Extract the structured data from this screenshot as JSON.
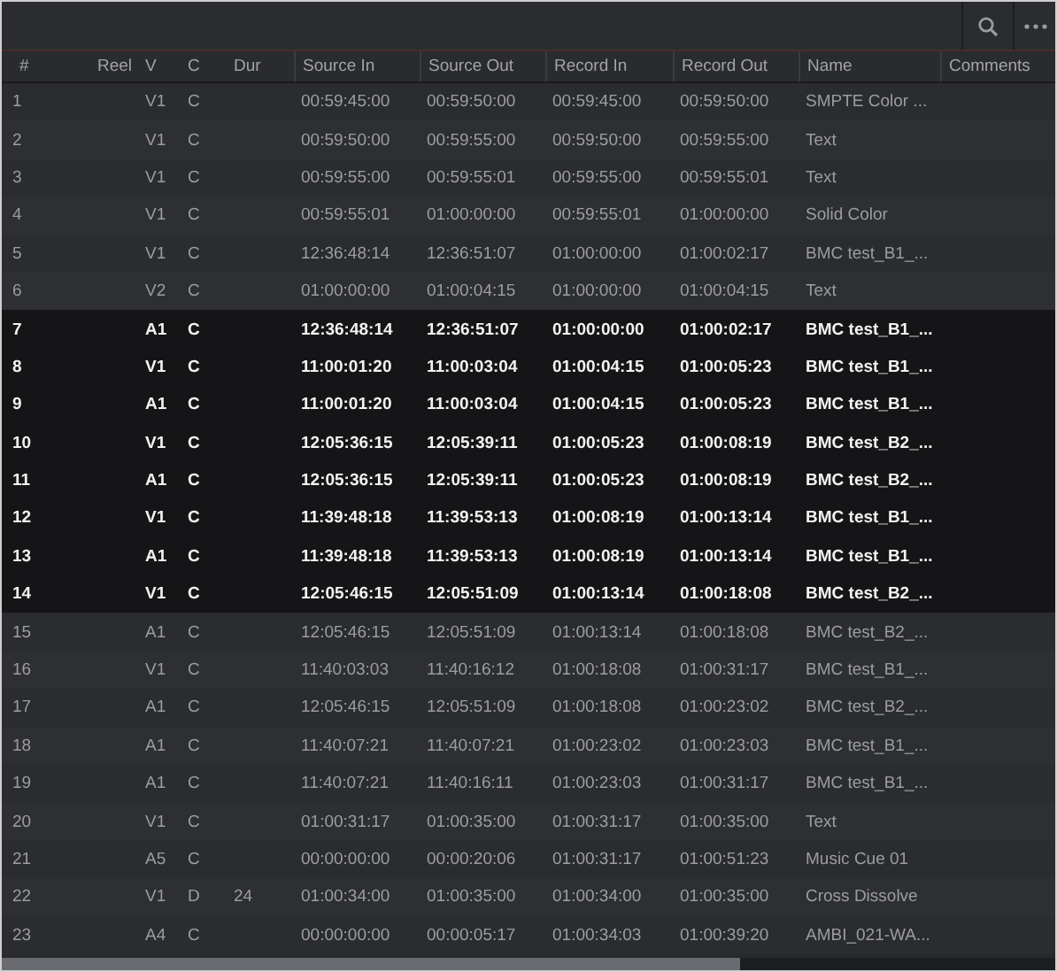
{
  "toolbar": {
    "buttons": [
      {
        "kind": "search"
      },
      {
        "kind": "more"
      }
    ]
  },
  "table": {
    "columns": [
      "#",
      "Reel",
      "V",
      "C",
      "Dur",
      "Source In",
      "Source Out",
      "Record In",
      "Record Out",
      "Name",
      "Comments"
    ],
    "rows": [
      {
        "number": "1",
        "v": "V1",
        "c": "C",
        "source_in": "00:59:45:00",
        "source_out": "00:59:50:00",
        "record_in": "00:59:45:00",
        "record_out": "00:59:50:00",
        "name": "SMPTE Color ...",
        "selected": false
      },
      {
        "number": "2",
        "v": "V1",
        "c": "C",
        "source_in": "00:59:50:00",
        "source_out": "00:59:55:00",
        "record_in": "00:59:50:00",
        "record_out": "00:59:55:00",
        "name": "Text",
        "selected": false
      },
      {
        "number": "3",
        "v": "V1",
        "c": "C",
        "source_in": "00:59:55:00",
        "source_out": "00:59:55:01",
        "record_in": "00:59:55:00",
        "record_out": "00:59:55:01",
        "name": "Text",
        "selected": false
      },
      {
        "number": "4",
        "v": "V1",
        "c": "C",
        "source_in": "00:59:55:01",
        "source_out": "01:00:00:00",
        "record_in": "00:59:55:01",
        "record_out": "01:00:00:00",
        "name": "Solid Color",
        "selected": false
      },
      {
        "number": "5",
        "v": "V1",
        "c": "C",
        "source_in": "12:36:48:14",
        "source_out": "12:36:51:07",
        "record_in": "01:00:00:00",
        "record_out": "01:00:02:17",
        "name": "BMC test_B1_...",
        "selected": false
      },
      {
        "number": "6",
        "v": "V2",
        "c": "C",
        "source_in": "01:00:00:00",
        "source_out": "01:00:04:15",
        "record_in": "01:00:00:00",
        "record_out": "01:00:04:15",
        "name": "Text",
        "selected": false
      },
      {
        "number": "7",
        "v": "A1",
        "c": "C",
        "source_in": "12:36:48:14",
        "source_out": "12:36:51:07",
        "record_in": "01:00:00:00",
        "record_out": "01:00:02:17",
        "name": "BMC test_B1_...",
        "selected": true
      },
      {
        "number": "8",
        "v": "V1",
        "c": "C",
        "source_in": "11:00:01:20",
        "source_out": "11:00:03:04",
        "record_in": "01:00:04:15",
        "record_out": "01:00:05:23",
        "name": "BMC test_B1_...",
        "selected": true
      },
      {
        "number": "9",
        "v": "A1",
        "c": "C",
        "source_in": "11:00:01:20",
        "source_out": "11:00:03:04",
        "record_in": "01:00:04:15",
        "record_out": "01:00:05:23",
        "name": "BMC test_B1_...",
        "selected": true
      },
      {
        "number": "10",
        "v": "V1",
        "c": "C",
        "source_in": "12:05:36:15",
        "source_out": "12:05:39:11",
        "record_in": "01:00:05:23",
        "record_out": "01:00:08:19",
        "name": "BMC test_B2_...",
        "selected": true
      },
      {
        "number": "11",
        "v": "A1",
        "c": "C",
        "source_in": "12:05:36:15",
        "source_out": "12:05:39:11",
        "record_in": "01:00:05:23",
        "record_out": "01:00:08:19",
        "name": "BMC test_B2_...",
        "selected": true
      },
      {
        "number": "12",
        "v": "V1",
        "c": "C",
        "source_in": "11:39:48:18",
        "source_out": "11:39:53:13",
        "record_in": "01:00:08:19",
        "record_out": "01:00:13:14",
        "name": "BMC test_B1_...",
        "selected": true
      },
      {
        "number": "13",
        "v": "A1",
        "c": "C",
        "source_in": "11:39:48:18",
        "source_out": "11:39:53:13",
        "record_in": "01:00:08:19",
        "record_out": "01:00:13:14",
        "name": "BMC test_B1_...",
        "selected": true
      },
      {
        "number": "14",
        "v": "V1",
        "c": "C",
        "source_in": "12:05:46:15",
        "source_out": "12:05:51:09",
        "record_in": "01:00:13:14",
        "record_out": "01:00:18:08",
        "name": "BMC test_B2_...",
        "selected": true
      },
      {
        "number": "15",
        "v": "A1",
        "c": "C",
        "source_in": "12:05:46:15",
        "source_out": "12:05:51:09",
        "record_in": "01:00:13:14",
        "record_out": "01:00:18:08",
        "name": "BMC test_B2_...",
        "selected": false
      },
      {
        "number": "16",
        "v": "V1",
        "c": "C",
        "source_in": "11:40:03:03",
        "source_out": "11:40:16:12",
        "record_in": "01:00:18:08",
        "record_out": "01:00:31:17",
        "name": "BMC test_B1_...",
        "selected": false
      },
      {
        "number": "17",
        "v": "A1",
        "c": "C",
        "source_in": "12:05:46:15",
        "source_out": "12:05:51:09",
        "record_in": "01:00:18:08",
        "record_out": "01:00:23:02",
        "name": "BMC test_B2_...",
        "selected": false
      },
      {
        "number": "18",
        "v": "A1",
        "c": "C",
        "source_in": "11:40:07:21",
        "source_out": "11:40:07:21",
        "record_in": "01:00:23:02",
        "record_out": "01:00:23:03",
        "name": "BMC test_B1_...",
        "selected": false
      },
      {
        "number": "19",
        "v": "A1",
        "c": "C",
        "source_in": "11:40:07:21",
        "source_out": "11:40:16:11",
        "record_in": "01:00:23:03",
        "record_out": "01:00:31:17",
        "name": "BMC test_B1_...",
        "selected": false
      },
      {
        "number": "20",
        "v": "V1",
        "c": "C",
        "source_in": "01:00:31:17",
        "source_out": "01:00:35:00",
        "record_in": "01:00:31:17",
        "record_out": "01:00:35:00",
        "name": "Text",
        "selected": false
      },
      {
        "number": "21",
        "v": "A5",
        "c": "C",
        "source_in": "00:00:00:00",
        "source_out": "00:00:20:06",
        "record_in": "01:00:31:17",
        "record_out": "01:00:51:23",
        "name": "Music Cue 01",
        "selected": false
      },
      {
        "number": "22",
        "v": "V1",
        "c": "D",
        "dur": "24",
        "source_in": "01:00:34:00",
        "source_out": "01:00:35:00",
        "record_in": "01:00:34:00",
        "record_out": "01:00:35:00",
        "name": "Cross Dissolve",
        "selected": false
      },
      {
        "number": "23",
        "v": "A4",
        "c": "C",
        "source_in": "00:00:00:00",
        "source_out": "00:00:05:17",
        "record_in": "01:00:34:03",
        "record_out": "01:00:39:20",
        "name": "AMBI_021-WA...",
        "selected": false
      }
    ]
  }
}
